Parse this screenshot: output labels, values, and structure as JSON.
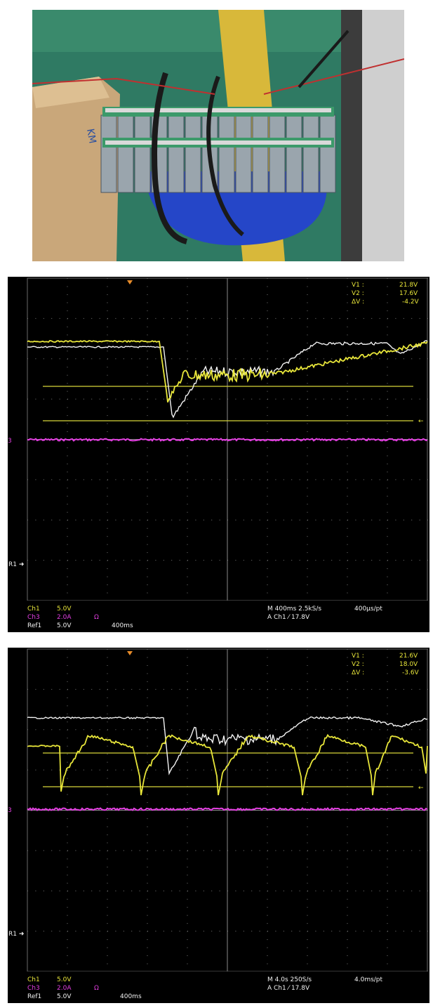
{
  "scope1": {
    "readout": {
      "v1_label": "V1 :",
      "v1": "21.8V",
      "v2_label": "V2 :",
      "v2": "17.6V",
      "dv_label": "ΔV :",
      "dv": "-4.2V"
    },
    "ch1_label": "Ch1",
    "ch1_scale": "5.0V",
    "ch3_label": "Ch3",
    "ch3_scale": "2.0A",
    "ch3_unit": "Ω",
    "ref1_label": "Ref1",
    "ref1_scale": "5.0V",
    "ref1_time": "400ms",
    "timebase": "M 400ms 2.5kS/s",
    "record": "400µs/pt",
    "trigger": "A  Ch1  ⁄  17.8V",
    "marker_r1": "R1 ➜",
    "marker_ch3": "3"
  },
  "scope2": {
    "readout": {
      "v1_label": "V1 :",
      "v1": "21.6V",
      "v2_label": "V2 :",
      "v2": "18.0V",
      "dv_label": "ΔV :",
      "dv": "-3.6V"
    },
    "ch1_label": "Ch1",
    "ch1_scale": "5.0V",
    "ch3_label": "Ch3",
    "ch3_scale": "2.0A",
    "ch3_unit": "Ω",
    "ref1_label": "Ref1",
    "ref1_scale": "5.0V",
    "ref1_time": "400ms",
    "timebase": "M 4.0s 250S/s",
    "record": "4.0ms/pt",
    "trigger": "A  Ch1  ⁄  17.8V",
    "marker_r1": "R1 ➜",
    "marker_ch3": "3"
  },
  "colors": {
    "ch1": "#e8e63a",
    "ch3": "#e23fe0",
    "ref1": "#f2f2f2",
    "grid": "#6a6a6a"
  },
  "photo": {
    "box_brand": "KM"
  }
}
